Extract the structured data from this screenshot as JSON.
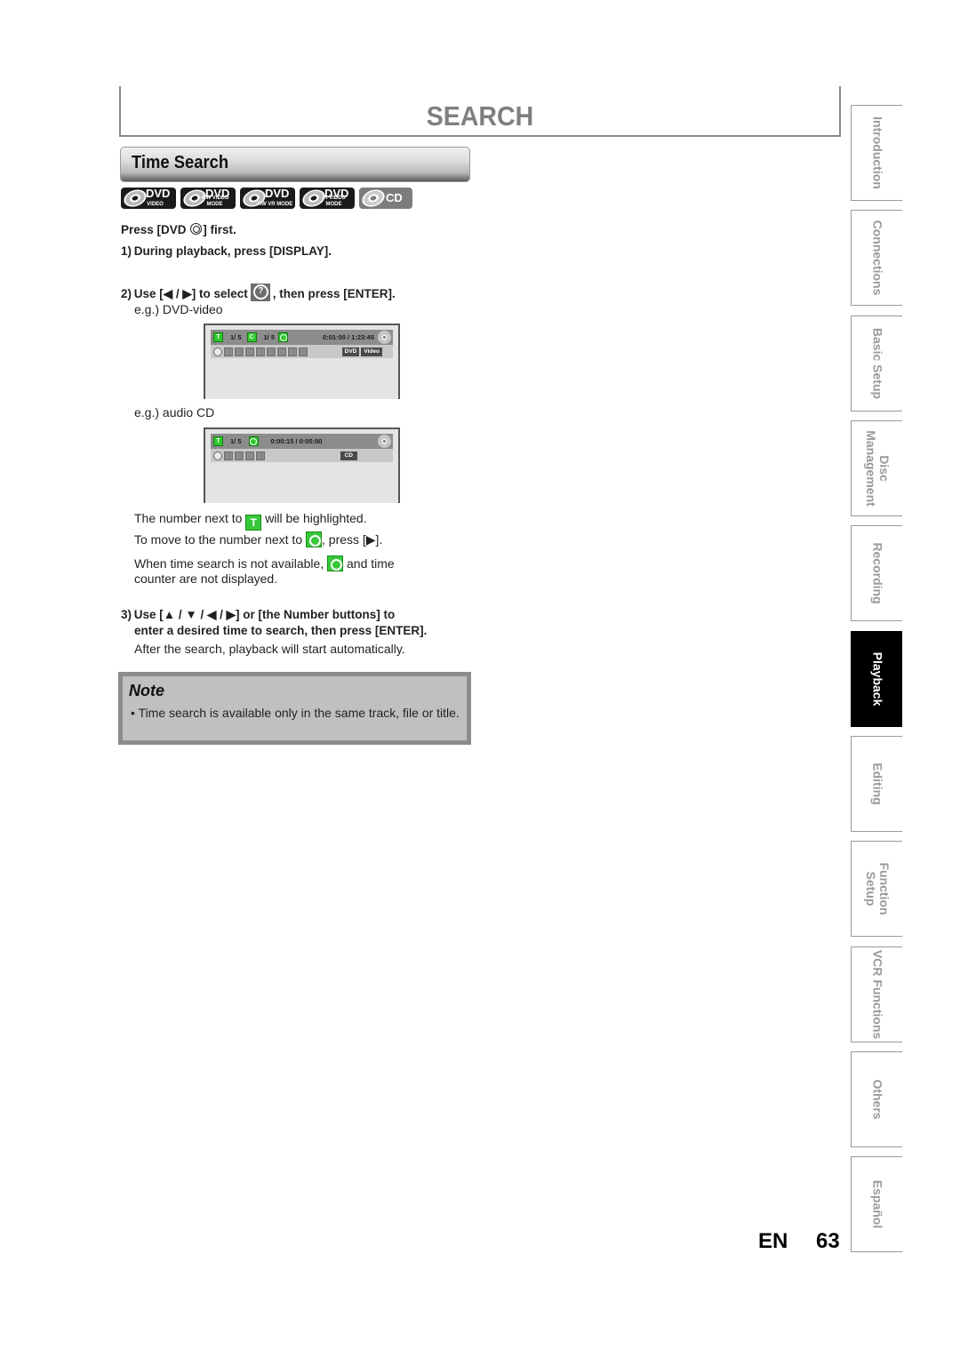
{
  "header": {
    "page_title": "SEARCH"
  },
  "section": {
    "title": "Time Search"
  },
  "media": [
    {
      "main": "DVD",
      "sub": "VIDEO",
      "icon": "dvd-video-disc-icon"
    },
    {
      "main": "DVD",
      "sub": "-RW VIDEO MODE",
      "icon": "dvd-rw-video-mode-disc-icon"
    },
    {
      "main": "DVD",
      "sub": "-RW VR MODE",
      "icon": "dvd-rw-vr-mode-disc-icon"
    },
    {
      "main": "DVD",
      "sub": "-R VIDEO MODE",
      "icon": "dvd-r-video-mode-disc-icon"
    },
    {
      "main": "CD",
      "sub": "",
      "icon": "cd-disc-icon"
    }
  ],
  "instructions": {
    "press_first_a": "Press [DVD ",
    "press_first_b": "] first.",
    "step1": "1) During playback, press [DISPLAY].",
    "step2_a": "2) Use [◀ / ▶] to select",
    "step2_b": ", then press [ENTER].",
    "example_dvd": "e.g.) DVD-video",
    "example_cd": "e.g.) audio CD",
    "highlight_a": "The number next to",
    "highlight_b": "will be highlighted.",
    "move_a": "To move to the number next to",
    "move_b": ", press [▶].",
    "unavailable_a": "When time search is not available,",
    "unavailable_b": "and time",
    "unavailable_c": "counter are not displayed.",
    "step3_line1": "3) Use [▲ / ▼ / ◀ / ▶] or [the Number buttons] to",
    "step3_line2": "enter a desired time to search, then press [ENTER].",
    "step3_after": "After the search, playback will start automatically.",
    "t_badge": "T"
  },
  "osd_dvd": {
    "title_badge": "T",
    "title_num": "1/  5",
    "chapter_badge": "C",
    "chapter_num": "1/  5",
    "time": "0:01:00 / 1:23:45",
    "tag1": "DVD",
    "tag2": "Video",
    "icons": [
      "search-icon",
      "audio-icon",
      "subtitle-icon",
      "angle-icon",
      "repeat-icon",
      "marker-icon",
      "noise-reduction-icon",
      "zoom-icon",
      "surround-icon"
    ]
  },
  "osd_cd": {
    "title_badge": "T",
    "title_num": "1/  5",
    "time": "0:00:15 / 0:05:00",
    "tag1": "CD",
    "icons": [
      "search-icon",
      "audio-icon",
      "repeat-icon",
      "marker-icon",
      "surround-icon"
    ]
  },
  "note": {
    "title": "Note",
    "text": "• Time search is available only in the same track, file or title."
  },
  "side_tabs": [
    {
      "label": "Introduction",
      "active": false
    },
    {
      "label": "Connections",
      "active": false
    },
    {
      "label": "Basic Setup",
      "active": false
    },
    {
      "label": "Disc\nManagement",
      "active": false
    },
    {
      "label": "Recording",
      "active": false
    },
    {
      "label": "Playback",
      "active": true
    },
    {
      "label": "Editing",
      "active": false
    },
    {
      "label": "Function\nSetup",
      "active": false
    },
    {
      "label": "VCR Functions",
      "active": false
    },
    {
      "label": "Others",
      "active": false
    },
    {
      "label": "Español",
      "active": false
    }
  ],
  "footer": {
    "lang": "EN",
    "page_number": "63"
  }
}
